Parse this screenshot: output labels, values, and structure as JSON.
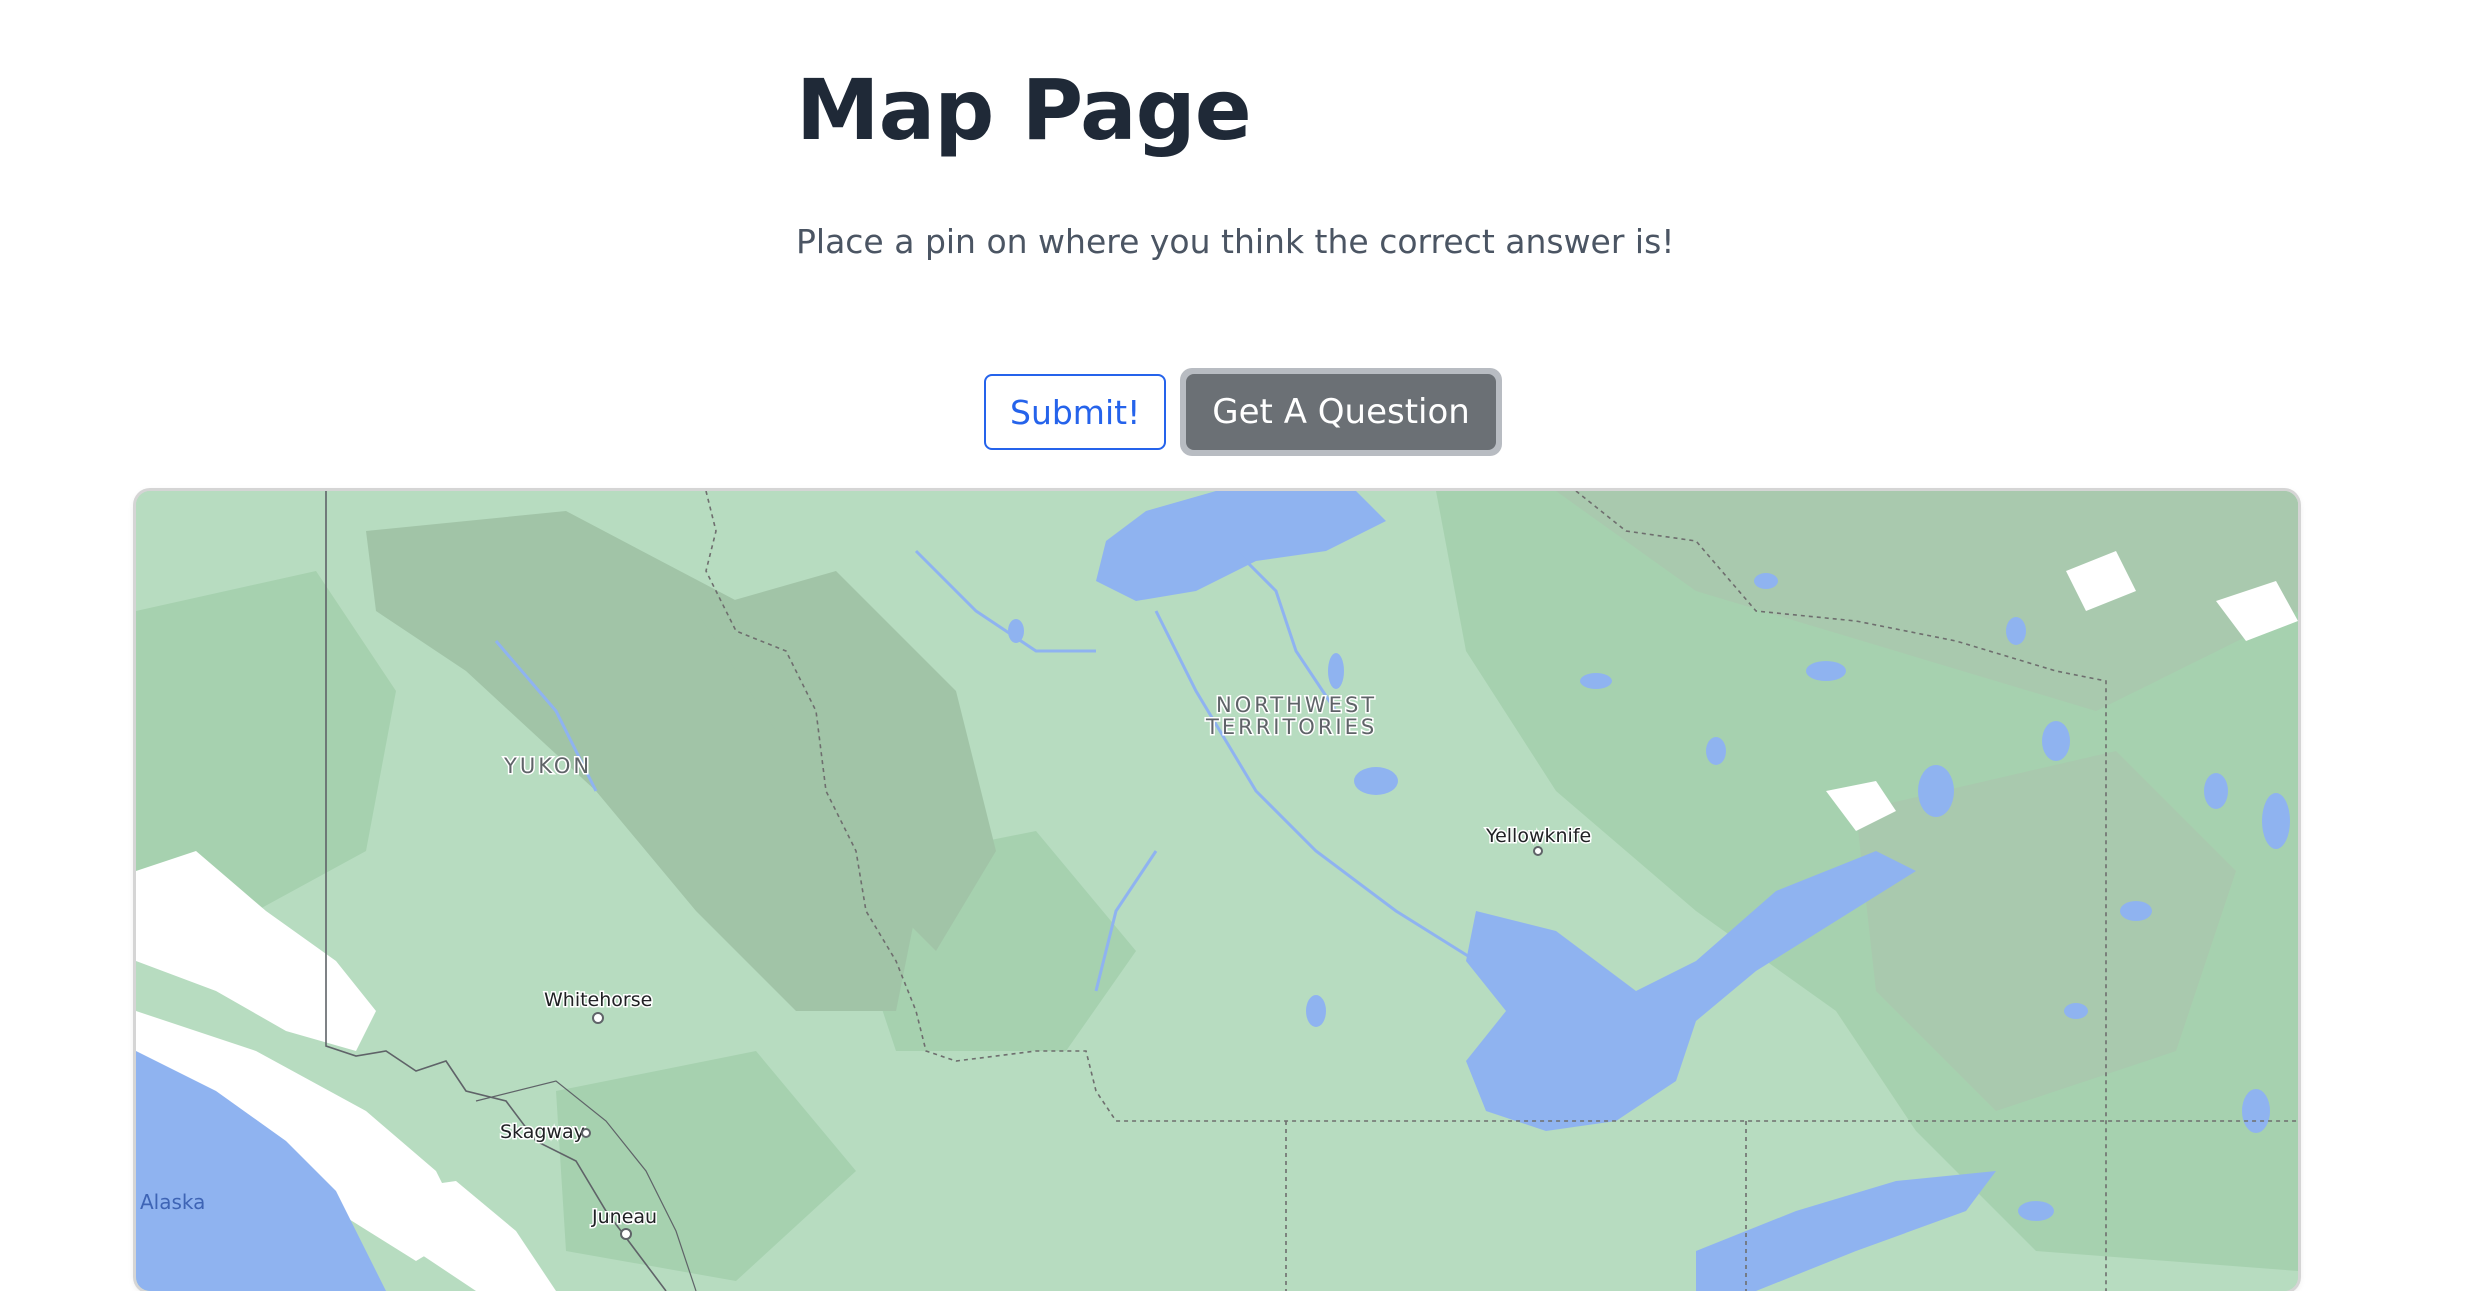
{
  "page": {
    "title": "Map Page",
    "instructions": "Place a pin on where you think the correct answer is!"
  },
  "buttons": {
    "submit_label": "Submit!",
    "get_question_label": "Get A Question"
  },
  "map": {
    "regions": {
      "northwest_territories_line1": "NORTHWEST",
      "northwest_territories_line2": "TERRITORIES",
      "yukon": "YUKON"
    },
    "cities": {
      "yellowknife": "Yellowknife",
      "whitehorse": "Whitehorse",
      "skagway": "Skagway",
      "juneau": "Juneau"
    },
    "water": {
      "alaska": "Alaska"
    },
    "colors": {
      "land": "#b7dcc0",
      "forest": "#a5d2ae",
      "mountain": "#9ec3a4",
      "water": "#8fb3f0",
      "snow": "#ffffff"
    }
  }
}
